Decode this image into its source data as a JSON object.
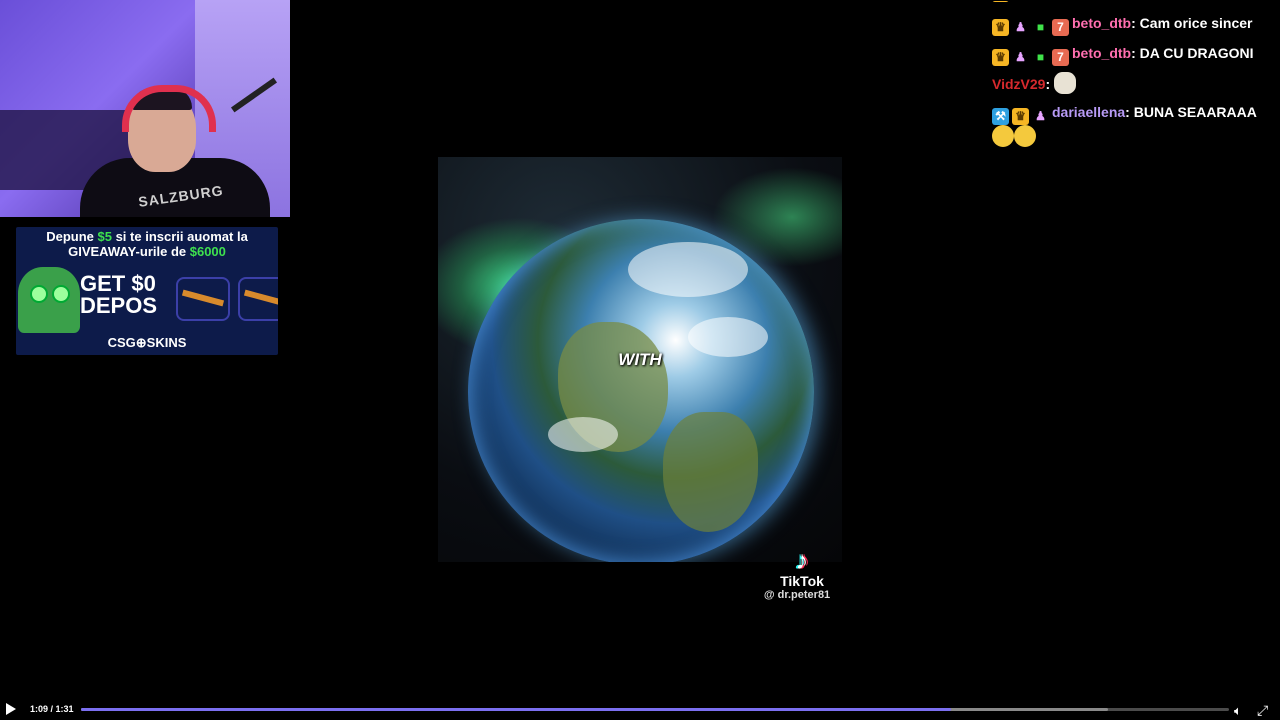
{
  "webcam": {
    "shirt_text": "SALZBURG"
  },
  "ad": {
    "line1_pre": "Depune ",
    "line1_amount": "$5",
    "line1_post": " si te inscrii auomat la",
    "line2_pre": "GIVEAWAY-urile de ",
    "line2_amount": "$6000",
    "headline_a": "GET $0",
    "headline_b": "DEPOS",
    "brand": "CSG⊕SKINS"
  },
  "video": {
    "caption": "WITH",
    "platform": "TikTok",
    "handle": "@ dr.peter81",
    "logo_glyph": "♪"
  },
  "chat": {
    "messages": [
      {
        "badges": [
          "crown",
          "sub",
          "gift",
          "pts"
        ],
        "user": "beto_dtb",
        "text": "Cam orice sincer"
      },
      {
        "badges": [
          "crown",
          "sub",
          "gift",
          "pts"
        ],
        "user": "beto_dtb",
        "text": "DA CU DRAGONI"
      },
      {
        "badges": [],
        "user": "VidzV29",
        "text": "",
        "emote": "cat"
      },
      {
        "badges": [
          "hammer",
          "crown",
          "sub"
        ],
        "user": "dariaellena",
        "text": "BUNA SEAARAAA",
        "emote": "pleading"
      }
    ]
  },
  "player": {
    "time": "1:09 / 1:31",
    "progress_fraction": 0.758,
    "buffered_fraction": 0.895,
    "accent": "#7b6ff0",
    "icons": {
      "play": "play-icon",
      "volume": "volume-icon",
      "fullscreen": "fullscreen-icon"
    }
  }
}
